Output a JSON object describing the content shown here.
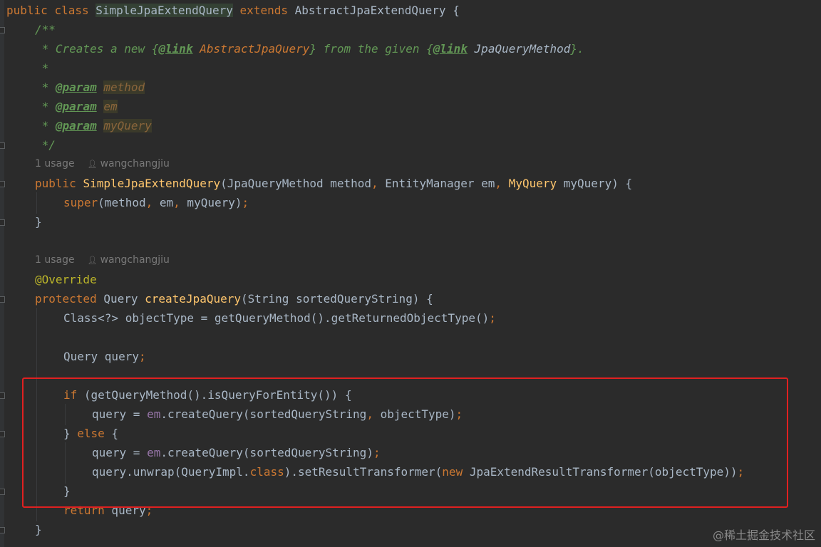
{
  "editor": {
    "line1": {
      "kw1": "public",
      "kw2": "class",
      "classname": "SimpleJpaExtendQuery",
      "kw3": "extends",
      "superclass": "AbstractJpaExtendQuery",
      "brace": "{"
    },
    "doc": {
      "open": "/**",
      "creates": " * Creates a new ",
      "link_tag": "@link",
      "link1": "AbstractJpaQuery",
      "from": "} from the given {",
      "link2": "JpaQueryMethod",
      "end": "}.",
      "star": " *",
      "param_tag": "@param",
      "param1": "method",
      "param2": "em",
      "param3": "myQuery",
      "close": " */"
    },
    "hint1": {
      "usages": "1 usage",
      "author": "wangchangjiu"
    },
    "ctor": {
      "kw": "public",
      "name": "SimpleJpaExtendQuery",
      "params_a": "(JpaQueryMethod method",
      "comma1": ",",
      "params_b": " EntityManager em",
      "comma2": ",",
      "type3": "MyQuery",
      "params_c": " myQuery) {"
    },
    "super_line": {
      "kw": "super",
      "args": "(method",
      "c1": ",",
      "a2": " em",
      "c2": ",",
      "a3": " myQuery)",
      "semi": ";"
    },
    "close1": "}",
    "hint2": {
      "usages": "1 usage",
      "author": "wangchangjiu"
    },
    "override": "@Override",
    "method": {
      "kw": "protected",
      "type": " Query ",
      "name": "createJpaQuery",
      "params": "(String sortedQueryString) {"
    },
    "objtype": {
      "text": "Class<?> objectType = getQueryMethod().getReturnedObjectType()",
      "semi": ";"
    },
    "query_decl": {
      "text": "Query query",
      "semi": ";"
    },
    "if_line": {
      "kw": "if",
      "text": " (getQueryMethod().isQueryForEntity()) {"
    },
    "assign1": {
      "a": "query = ",
      "fld": "em",
      "b": ".createQuery(sortedQueryString",
      "c": ",",
      "d": " objectType)",
      "semi": ";"
    },
    "else_line": {
      "a": "} ",
      "kw": "else",
      "b": " {"
    },
    "assign2": {
      "a": "query = ",
      "fld": "em",
      "b": ".createQuery(sortedQueryString)",
      "semi": ";"
    },
    "unwrap": {
      "a": "query.unwrap(QueryImpl.",
      "kw": "class",
      "b": ").setResultTransformer(",
      "kw2": "new",
      "c": " JpaExtendResultTransformer(objectType))",
      "semi": ";"
    },
    "close_if": "}",
    "return_line": {
      "kw": "return",
      "text": " query",
      "semi": ";"
    },
    "close2": "}"
  },
  "watermark": "@稀土掘金技术社区"
}
